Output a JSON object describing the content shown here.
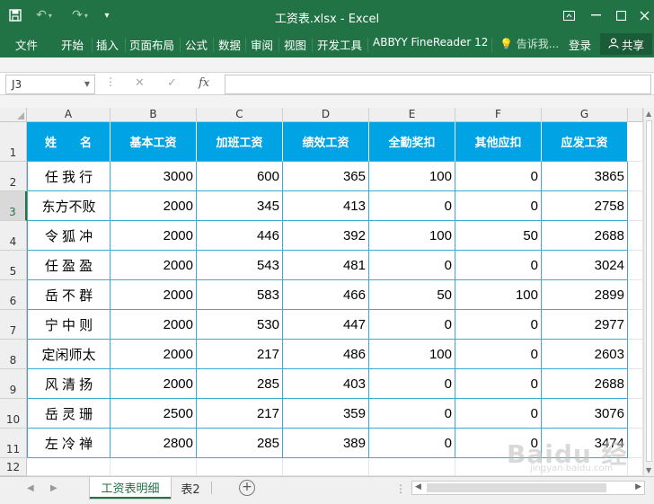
{
  "window": {
    "title": "工资表.xlsx - Excel"
  },
  "quick_access": {
    "save_icon": "save-icon",
    "undo_icon": "undo-icon",
    "redo_icon": "redo-icon",
    "customize_icon": "chevron-down-icon"
  },
  "ribbon": {
    "tabs": [
      "文件",
      "开始",
      "插入",
      "页面布局",
      "公式",
      "数据",
      "审阅",
      "视图",
      "开发工具",
      "ABBYY FineReader 12"
    ],
    "tell_me": "告诉我...",
    "login": "登录",
    "share": "共享"
  },
  "formula_bar": {
    "name_box": "J3",
    "fx": "fx",
    "content": ""
  },
  "grid": {
    "columns": [
      "A",
      "B",
      "C",
      "D",
      "E",
      "F",
      "G"
    ],
    "rows": [
      "1",
      "2",
      "3",
      "4",
      "5",
      "6",
      "7",
      "8",
      "9",
      "10",
      "11",
      "12"
    ],
    "selected_row": "3",
    "header": [
      "姓　　名",
      "基本工资",
      "加班工资",
      "绩效工资",
      "全勤奖扣",
      "其他应扣",
      "应发工资"
    ],
    "data": [
      [
        "任 我 行",
        "3000",
        "600",
        "365",
        "100",
        "0",
        "3865"
      ],
      [
        "东方不败",
        "2000",
        "345",
        "413",
        "0",
        "0",
        "2758"
      ],
      [
        "令 狐 冲",
        "2000",
        "446",
        "392",
        "100",
        "50",
        "2688"
      ],
      [
        "任 盈 盈",
        "2000",
        "543",
        "481",
        "0",
        "0",
        "3024"
      ],
      [
        "岳 不 群",
        "2000",
        "583",
        "466",
        "50",
        "100",
        "2899"
      ],
      [
        "宁 中 则",
        "2000",
        "530",
        "447",
        "0",
        "0",
        "2977"
      ],
      [
        "定闲师太",
        "2000",
        "217",
        "486",
        "100",
        "0",
        "2603"
      ],
      [
        "风 清 扬",
        "2000",
        "285",
        "403",
        "0",
        "0",
        "2688"
      ],
      [
        "岳 灵 珊",
        "2500",
        "217",
        "359",
        "0",
        "0",
        "3076"
      ],
      [
        "左 冷 禅",
        "2800",
        "285",
        "389",
        "0",
        "0",
        "3474"
      ]
    ]
  },
  "sheets": {
    "tabs": [
      "工资表明细",
      "表2"
    ],
    "active": "工资表明细"
  },
  "watermark": {
    "text": "Baidu 经验",
    "url": "jingyan.baidu.com"
  },
  "colors": {
    "excel_green": "#217346",
    "header_fill": "#00a4e4",
    "cell_border": "#3fa9d6"
  }
}
